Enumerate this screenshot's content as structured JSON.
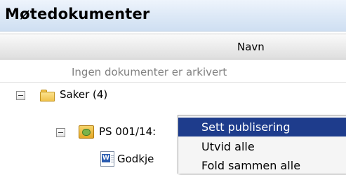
{
  "header": {
    "title": "Møtedokumenter"
  },
  "table": {
    "column_header": "Navn",
    "empty_message": "Ingen dokumenter er arkivert"
  },
  "tree": {
    "folder": {
      "label": "Saker (4)",
      "icon": "folder-icon"
    },
    "case": {
      "label": "PS 001/14:",
      "icon": "case-icon"
    },
    "document": {
      "label": "Godkje",
      "icon": "word-document-icon"
    }
  },
  "context_menu": {
    "items": [
      {
        "label": "Sett publisering",
        "selected": true
      },
      {
        "label": "Utvid alle",
        "selected": false
      },
      {
        "label": "Fold sammen alle",
        "selected": false
      }
    ]
  },
  "colors": {
    "selection": "#1e3c8c",
    "header_bg": "#dce8f6",
    "muted_text": "#808080"
  }
}
